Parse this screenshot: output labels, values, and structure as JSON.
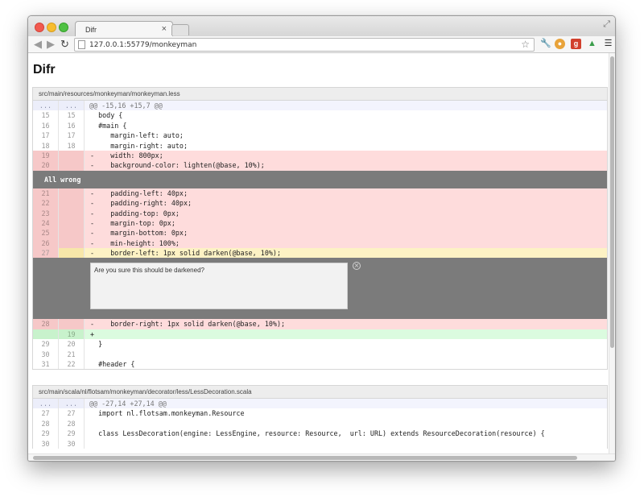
{
  "browser": {
    "tab_title": "Difr",
    "tab_close": "×",
    "url": "127.0.0.1:55779/monkeyman",
    "icons": {
      "back": "◀",
      "forward": "▶",
      "reload": "↻",
      "star": "☆",
      "wrench": "🔧",
      "cookie": "●",
      "gplus": "g",
      "drive": "▲",
      "menu": "☰",
      "fullscreen": "⤢"
    }
  },
  "page": {
    "title": "Difr"
  },
  "files": [
    {
      "path": "src/main/resources/monkeyman/monkeyman.less",
      "hunk": {
        "old": "...",
        "new": "...",
        "header": "@@ -15,16 +15,7 @@"
      },
      "lines_a": [
        {
          "old": "15",
          "new": "15",
          "type": "ctx",
          "code": "  body {"
        },
        {
          "old": "16",
          "new": "16",
          "type": "ctx",
          "code": "  #main {"
        },
        {
          "old": "17",
          "new": "17",
          "type": "ctx",
          "code": "     margin-left: auto;"
        },
        {
          "old": "18",
          "new": "18",
          "type": "ctx",
          "code": "     margin-right: auto;"
        },
        {
          "old": "19",
          "new": "",
          "type": "del",
          "code": "-    width: 800px;"
        },
        {
          "old": "20",
          "new": "",
          "type": "del",
          "code": "-    background-color: lighten(@base, 10%);"
        }
      ],
      "comment_saved": "All wrong",
      "lines_b": [
        {
          "old": "21",
          "new": "",
          "type": "del",
          "code": "-    padding-left: 40px;"
        },
        {
          "old": "22",
          "new": "",
          "type": "del",
          "code": "-    padding-right: 40px;"
        },
        {
          "old": "23",
          "new": "",
          "type": "del",
          "code": "-    padding-top: 0px;"
        },
        {
          "old": "24",
          "new": "",
          "type": "del",
          "code": "-    margin-top: 0px;"
        },
        {
          "old": "25",
          "new": "",
          "type": "del",
          "code": "-    margin-bottom: 0px;"
        },
        {
          "old": "26",
          "new": "",
          "type": "del",
          "code": "-    min-height: 100%;"
        },
        {
          "old": "27",
          "new": "",
          "type": "sel",
          "code": "-    border-left: 1px solid darken(@base, 10%);"
        }
      ],
      "comment_draft": "Are you sure this should be darkened?",
      "comment_close": "×",
      "lines_c": [
        {
          "old": "28",
          "new": "",
          "type": "del",
          "code": "-    border-right: 1px solid darken(@base, 10%);"
        },
        {
          "old": "",
          "new": "19",
          "type": "add",
          "code": "+"
        },
        {
          "old": "29",
          "new": "20",
          "type": "ctx",
          "code": "  }"
        },
        {
          "old": "30",
          "new": "21",
          "type": "ctx",
          "code": ""
        },
        {
          "old": "31",
          "new": "22",
          "type": "ctx",
          "code": "  #header {"
        }
      ]
    },
    {
      "path": "src/main/scala/nl/flotsam/monkeyman/decorator/less/LessDecoration.scala",
      "hunk": {
        "old": "...",
        "new": "...",
        "header": "@@ -27,14 +27,14 @@"
      },
      "lines_a": [
        {
          "old": "27",
          "new": "27",
          "type": "ctx",
          "code": "  import nl.flotsam.monkeyman.Resource"
        },
        {
          "old": "28",
          "new": "28",
          "type": "ctx",
          "code": ""
        },
        {
          "old": "29",
          "new": "29",
          "type": "ctx",
          "code": "  class LessDecoration(engine: LessEngine, resource: Resource,  url: URL) extends ResourceDecoration(resource) {"
        },
        {
          "old": "30",
          "new": "30",
          "type": "ctx",
          "code": ""
        }
      ]
    }
  ]
}
